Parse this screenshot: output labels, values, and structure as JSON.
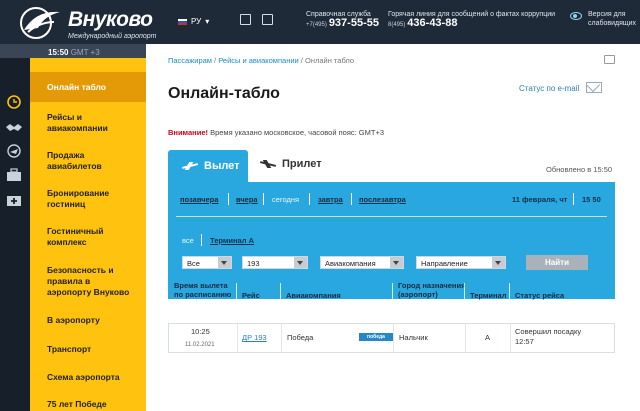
{
  "header": {
    "brand": "Внуково",
    "brand_sub": "Международный аэропорт",
    "lang": "РУ",
    "time": "15:50",
    "tz": "GMT +3",
    "help_title": "Справочная служба",
    "help_prefix": "+7(495)",
    "help_number": "937-55-55",
    "hotline_title": "Горячая линия для сообщений о фактах коррупции",
    "hotline_prefix": "8(495)",
    "hotline_number": "436-43-88",
    "vision_line1": "Версия для",
    "vision_line2": "слабовидящих"
  },
  "sidebar": {
    "items": [
      {
        "label": "Онлайн табло",
        "active": true
      },
      {
        "label": "Рейсы и авиакомпании"
      },
      {
        "label": "Продажа авиабилетов"
      },
      {
        "label": "Бронирование гостиниц"
      },
      {
        "label": "Гостиничный комплекс"
      },
      {
        "label": "Безопасность и правила в аэропорту Внуково"
      },
      {
        "label": "В аэропорту"
      },
      {
        "label": "Транспорт"
      },
      {
        "label": "Схема аэропорта"
      },
      {
        "label": "75 лет Победе"
      }
    ],
    "icons": [
      "clock-icon",
      "handshake-icon",
      "plane-circle-icon",
      "suitcase-icon",
      "first-aid-icon"
    ]
  },
  "main": {
    "breadcrumbs": [
      "Пассажирам",
      "Рейсы и авиакомпании",
      "Онлайн табло"
    ],
    "title": "Онлайн-табло",
    "mail_status": "Статус по e-mail",
    "notice_label": "Внимание!",
    "notice_text": " Время указано московское, часовой пояс: GMT+3",
    "tabs": {
      "departure": "Вылет",
      "arrival": "Прилет"
    },
    "updated": "Обновлено в 15:50",
    "days": [
      "позавчера",
      "вчера",
      "сегодня",
      "завтра",
      "послезавтра"
    ],
    "current_day": "сегодня",
    "date": "11 февраля, чт",
    "clock": "15 50",
    "terminals": [
      "все",
      "Терминал А"
    ],
    "filters": {
      "type": "Все",
      "flight": "193",
      "airline": "Авиакомпания",
      "direction": "Направление",
      "find": "Найти"
    },
    "columns": [
      "Время вылета по расписанию",
      "Рейс",
      "Авиакомпания",
      "Город назначения (аэропорт)",
      "Терминал",
      "Статус рейса"
    ],
    "rows": [
      {
        "time": "10:25",
        "date": "11.02.2021",
        "flight": "ДР 193",
        "airline": "Победа",
        "airline_logo": "победа",
        "city": "Нальчик",
        "terminal": "А",
        "status": "Совершил посадку 12:57"
      }
    ]
  },
  "colors": {
    "accent": "#29a7df",
    "sidebar": "#ffc20e",
    "active": "#e49a06",
    "header": "#1e2a38"
  }
}
